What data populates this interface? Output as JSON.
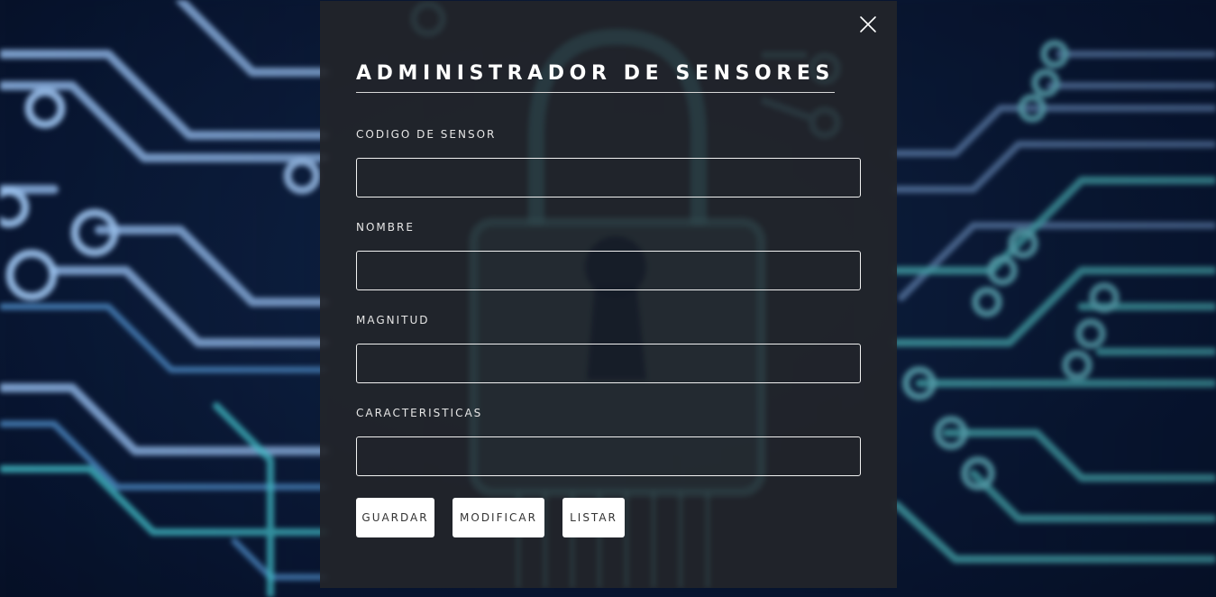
{
  "modal": {
    "title": "ADMINISTRADOR DE SENSORES",
    "close_icon": "close-icon"
  },
  "form": {
    "fields": [
      {
        "label": "CODIGO DE SENSOR",
        "value": "",
        "placeholder": ""
      },
      {
        "label": "NOMBRE",
        "value": "",
        "placeholder": ""
      },
      {
        "label": "MAGNITUD",
        "value": "",
        "placeholder": ""
      },
      {
        "label": "CARACTERISTICAS",
        "value": "",
        "placeholder": ""
      }
    ],
    "buttons": {
      "save_label": "GUARDAR",
      "modify_label": "MODIFICAR",
      "list_label": "LISTAR"
    }
  },
  "background": {
    "theme": "circuit-board",
    "watermark_icon": "padlock-icon"
  },
  "colors": {
    "page_background": "#0c1d3c",
    "circuit_light": "#8fb6e6",
    "circuit_teal": "#5ad6d6",
    "modal_background": "#22252a",
    "text": "#ffffff",
    "button_background": "#ffffff",
    "button_text": "#333333"
  }
}
